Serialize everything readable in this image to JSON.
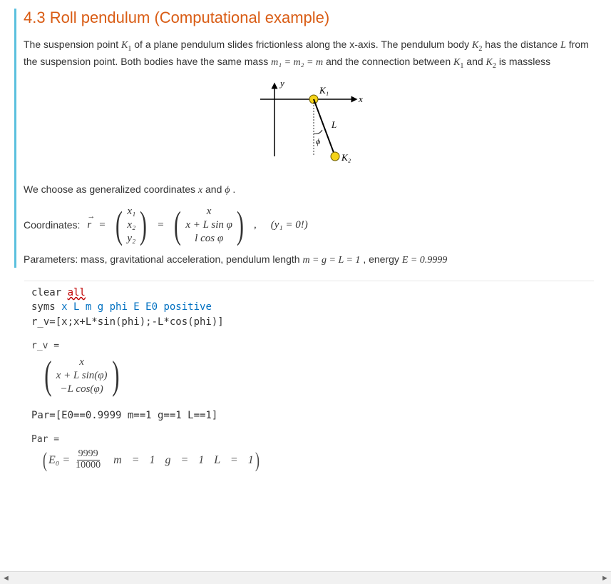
{
  "section": {
    "title": "4.3 Roll pendulum (Computational example)",
    "intro_parts": {
      "p1a": "The suspension point ",
      "K1": "K",
      "K1sub": "1",
      "p1b": " of a plane pendulum slides frictionless along the x-axis. The pendulum body ",
      "K2": "K",
      "K2sub": "2",
      "p1c": " has the distance ",
      "Lsym": "L",
      "p1d": " from the suspension point. Both bodies have the same mass ",
      "masses": "m₁ = m₂ = m",
      "p1e": " and the connection between ",
      "K1b": "K",
      "K1bsub": "1",
      "p1f": " and ",
      "K2b": "K",
      "K2bsub": "2",
      "p1g": " is massless"
    },
    "gen_coords_line": {
      "a": "We choose as generalized coordinates ",
      "x": "x",
      "b": " and ",
      "phi": "ϕ",
      "c": " ."
    },
    "coord_eq": {
      "label": "Coordinates:  ",
      "r": "r",
      "vec1": [
        "x₁",
        "x₂",
        "y₂"
      ],
      "vec2": [
        "x",
        "x + L sin φ",
        "l cos φ"
      ],
      "note": "(y₁ = 0!)"
    },
    "params_line": {
      "a": "Parameters: mass, gravitational acceleration, pendulum length ",
      "eq": "m = g = L = 1",
      "b": ", energy ",
      "E": "E = 0.9999"
    }
  },
  "diagram": {
    "y": "y",
    "x": "x",
    "K1": "K₁",
    "K2": "K₂",
    "L": "L",
    "phi": "ϕ"
  },
  "code": {
    "l1a": "clear ",
    "l1b": "all",
    "l2a": "syms ",
    "l2b": "x L m g phi E E0 positive",
    "l3": "r_v=[x;x+L*sin(phi);-L*cos(phi)]"
  },
  "out1": {
    "var": "r_v =",
    "rows": [
      "x",
      "x + L sin(φ)",
      "−L cos(φ)"
    ]
  },
  "code2": {
    "l1": "Par=[E0==0.9999 m==1 g==1 L==1]"
  },
  "out2": {
    "var": "Par =",
    "E0": "E₀",
    "frac_num": "9999",
    "frac_den": "10000",
    "rest": "m = 1   g = 1   L = 1"
  },
  "scrollbar": {
    "left": "◄",
    "right": "►"
  }
}
